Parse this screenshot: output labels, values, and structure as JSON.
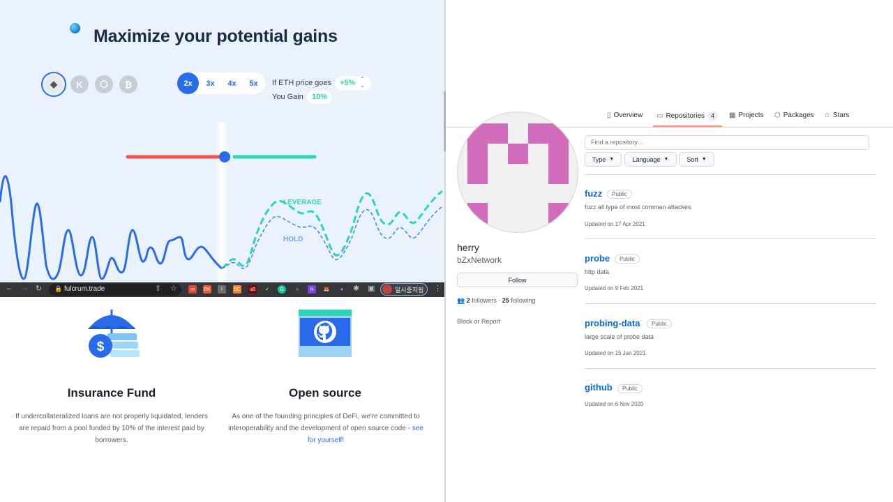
{
  "left": {
    "hero": {
      "title": "Maximize your potential gains",
      "coins": [
        {
          "name": "eth-coin",
          "glyph": "◆",
          "active": true
        },
        {
          "name": "coin-2",
          "glyph": "K",
          "active": false
        },
        {
          "name": "coin-3",
          "glyph": "⬡",
          "active": false
        },
        {
          "name": "coin-4",
          "glyph": "₿",
          "active": false
        }
      ],
      "leverage_options": [
        "2x",
        "3x",
        "4x",
        "5x"
      ],
      "selected_leverage": "2x",
      "if_label": "If ETH price goes",
      "price_change": "+5%",
      "gain_label": "You Gain",
      "gain_value": "10%",
      "leverage_curve_label": "LEVERAGE",
      "hold_curve_label": "HOLD"
    },
    "browser": {
      "url": "fulcrum.trade",
      "profile_label": "일시중지됨",
      "extensions": [
        {
          "label": "m",
          "color": "#e0453a"
        },
        {
          "label": "BK",
          "color": "#e8572c"
        },
        {
          "label": "I",
          "color": "#6c6c6c"
        },
        {
          "label": "SC",
          "color": "#f0822d"
        },
        {
          "label": "uB",
          "color": "#800000"
        },
        {
          "label": "✓",
          "color": "#35363a"
        },
        {
          "label": "G",
          "color": "#15c39a"
        },
        {
          "label": "∩",
          "color": "#35363a"
        },
        {
          "label": "N",
          "color": "#7b3fe4"
        },
        {
          "label": "🦊",
          "color": "#35363a"
        },
        {
          "label": "●",
          "color": "#35363a"
        }
      ]
    },
    "features": [
      {
        "title": "Insurance Fund",
        "body": "If undercollateralized loans are not properly liquidated, lenders are repaid from a pool funded by 10% of the interest paid by borrowers."
      },
      {
        "title": "Open source",
        "body": "As one of the founding principles of DeFi, we're committed to interoperability and the development of open source code - ",
        "link": "see for yourself!"
      }
    ]
  },
  "right": {
    "tabs": [
      {
        "label": "Overview",
        "icon": "book-icon"
      },
      {
        "label": "Repositories",
        "icon": "repo-icon",
        "count": "4",
        "active": true
      },
      {
        "label": "Projects",
        "icon": "table-icon"
      },
      {
        "label": "Packages",
        "icon": "package-icon"
      },
      {
        "label": "Stars",
        "icon": "star-icon"
      }
    ],
    "profile": {
      "username": "herry",
      "org": "bZxNetwork",
      "follow_label": "Follow",
      "followers_count": "2",
      "followers_label": "followers",
      "following_count": "25",
      "following_label": "following",
      "block_label": "Block or Report",
      "avatar_color": "#d26cbd"
    },
    "search_placeholder": "Find a repository…",
    "filters": [
      "Type",
      "Language",
      "Sort"
    ],
    "repos": [
      {
        "name": "fuzz",
        "visibility": "Public",
        "description": "fuzz all type of most comman attackes",
        "updated": "Updated on 17 Apr 2021"
      },
      {
        "name": "probe",
        "visibility": "Public",
        "description": "http data",
        "updated": "Updated on 9 Feb 2021"
      },
      {
        "name": "probing-data",
        "visibility": "Public",
        "description": "large scale of probe data",
        "updated": "Updated on 15 Jan 2021"
      },
      {
        "name": "github",
        "visibility": "Public",
        "description": "",
        "updated": "Updated on 6 Nov 2020"
      }
    ]
  }
}
